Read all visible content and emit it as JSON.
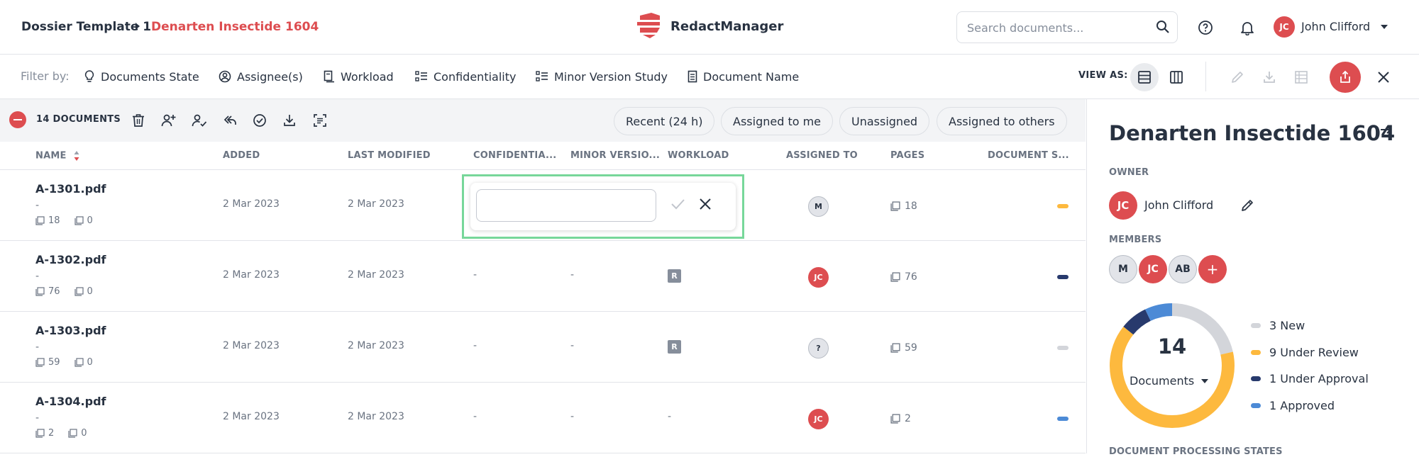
{
  "breadcrumb": {
    "template": "Dossier Template 1",
    "dossier": "Denarten Insectide 1604"
  },
  "brand": {
    "name": "RedactManager"
  },
  "search": {
    "placeholder": "Search documents..."
  },
  "user": {
    "initials": "JC",
    "name": "John Clifford"
  },
  "filters": {
    "label": "Filter by:",
    "items": [
      "Documents State",
      "Assignee(s)",
      "Workload",
      "Confidentiality",
      "Minor Version Study",
      "Document Name"
    ]
  },
  "view_as": {
    "label": "VIEW AS:"
  },
  "toolbar": {
    "count_label": "14 DOCUMENTS",
    "quick_filters": [
      "Recent (24 h)",
      "Assigned to me",
      "Unassigned",
      "Assigned to others"
    ]
  },
  "table": {
    "columns": [
      "NAME",
      "ADDED",
      "LAST MODIFIED",
      "CONFIDENTIA...",
      "MINOR VERSIO...",
      "WORKLOAD",
      "ASSIGNED TO",
      "PAGES",
      "DOCUMENT S..."
    ],
    "rows": [
      {
        "name": "A-1301.pdf",
        "sub": "-",
        "pages_meta": "18",
        "ann_meta": "0",
        "added": "2 Mar 2023",
        "modified": "2 Mar 2023",
        "confidentiality": "",
        "minor_version": "",
        "workload": "",
        "assignee": "M",
        "assignee_type": "grey",
        "pages": "18",
        "state_color": "#fdb93e"
      },
      {
        "name": "A-1302.pdf",
        "sub": "-",
        "pages_meta": "76",
        "ann_meta": "0",
        "added": "2 Mar 2023",
        "modified": "2 Mar 2023",
        "confidentiality": "-",
        "minor_version": "-",
        "workload": "R",
        "assignee": "JC",
        "assignee_type": "red",
        "pages": "76",
        "state_color": "#283a6d"
      },
      {
        "name": "A-1303.pdf",
        "sub": "-",
        "pages_meta": "59",
        "ann_meta": "0",
        "added": "2 Mar 2023",
        "modified": "2 Mar 2023",
        "confidentiality": "-",
        "minor_version": "-",
        "workload": "R",
        "assignee": "?",
        "assignee_type": "grey",
        "pages": "59",
        "state_color": "#d3d5da"
      },
      {
        "name": "A-1304.pdf",
        "sub": "-",
        "pages_meta": "2",
        "ann_meta": "0",
        "added": "2 Mar 2023",
        "modified": "2 Mar 2023",
        "confidentiality": "-",
        "minor_version": "-",
        "workload": "-",
        "assignee": "JC",
        "assignee_type": "red",
        "pages": "2",
        "state_color": "#4c8ad6"
      }
    ]
  },
  "inline_edit": {
    "value": ""
  },
  "side": {
    "title": "Denarten Insectide 1604",
    "owner_label": "OWNER",
    "owner": {
      "initials": "JC",
      "name": "John Clifford"
    },
    "members_label": "MEMBERS",
    "members": [
      {
        "initials": "M",
        "type": "grey"
      },
      {
        "initials": "JC",
        "type": "red"
      },
      {
        "initials": "AB",
        "type": "grey"
      },
      {
        "initials": "+",
        "type": "red"
      }
    ],
    "donut": {
      "total": "14",
      "label": "Documents"
    },
    "legend": [
      {
        "label": "3 New",
        "count": 3,
        "color": "#d3d5da"
      },
      {
        "label": "9 Under Review",
        "count": 9,
        "color": "#fdb93e"
      },
      {
        "label": "1 Under Approval",
        "count": 1,
        "color": "#283a6d"
      },
      {
        "label": "1 Approved",
        "count": 1,
        "color": "#4c8ad6"
      }
    ],
    "bottom_label": "DOCUMENT PROCESSING STATES"
  },
  "colors": {
    "accent": "#dd4d50",
    "text": "#283241",
    "muted": "#6a7381",
    "highlight": "#77d79a"
  }
}
